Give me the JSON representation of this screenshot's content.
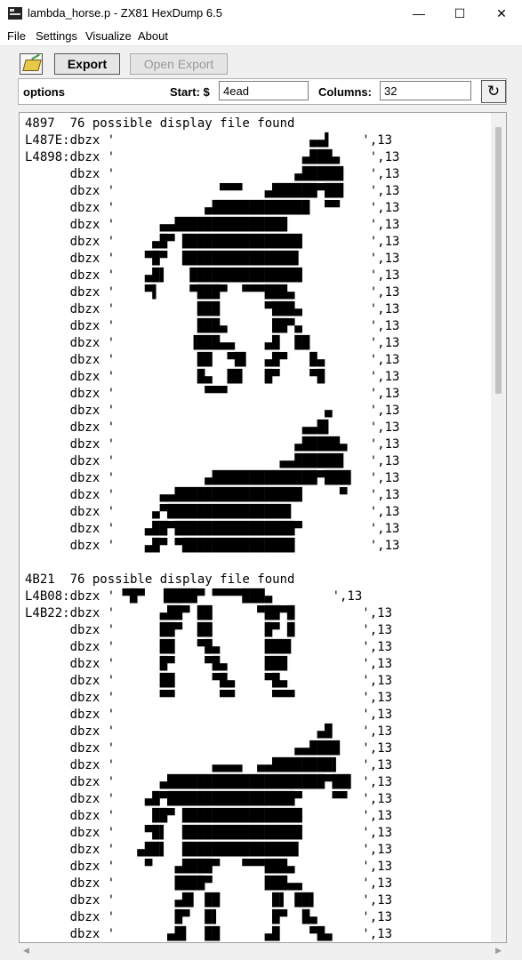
{
  "window": {
    "title": "lambda_horse.p - ZX81 HexDump 6.5",
    "minimize": "—",
    "maximize": "☐",
    "close": "✕"
  },
  "menu": [
    "File",
    "Settings",
    "Visualize",
    "About"
  ],
  "toolbar": {
    "open_icon": "open-folder-icon",
    "export_label": "Export",
    "open_export_label": "Open Export"
  },
  "options": {
    "label": "options",
    "start_label": "Start: $",
    "start_value": "4ead",
    "columns_label": "Columns:",
    "columns_value": "32",
    "refresh_icon": "↻"
  },
  "output_lines": [
    "4897  76 possible display file found",
    "L487E:dbzx '                          ▄▄▌    ',13",
    "L4898:dbzx '                         ▄███▄    ',13",
    "      dbzx '                        ▄█████▌   ',13",
    "      dbzx '              ▀▀▀   ▄██████▀██▌   ',13",
    "      dbzx '            ▄█████████████  ▀▀    ',13",
    "      dbzx '      ▄▄███████████████           ',13",
    "      dbzx '     ▄█▀ ████████████████         ',13",
    "      dbzx '    ▀█▀  ███████████████▌         ',13",
    "      dbzx '    ▄█▌   ███████████████         ',13",
    "      dbzx '    ▀▌    ▀███▀  ▀▀▀███▄          ',13",
    "      dbzx '           ███      ▀███▄         ',13",
    "      dbzx '           ███▄      ██▀▄         ',13",
    "      dbzx '          ▐███▄▄    ▄█  ██        ',13",
    "      dbzx '           ██  ▀█▌  ▄█▀   █▄      ',13",
    "      dbzx '           █▄  ██   █▀    ▀█      ',13",
    "      dbzx '            ▀▀▀                   ',13",
    "      dbzx '                            ▄     ',13",
    "      dbzx '                         ▄▄█▌     ',13",
    "      dbzx '                        ▄█████▄   ',13",
    "      dbzx '                      ▄▄██████▌   ',13",
    "      dbzx '            ▄██████████████▀███▌  ',13",
    "      dbzx '      ▄▄█████████████████     ▀   ',13",
    "      dbzx '     ▄▀████████████████▌          ',13",
    "      dbzx '    ▄██▀████████████████▀         ',13",
    "      dbzx '    ▄█▀ ▀███████████████          ',13",
    "",
    "4B21  76 possible display file found",
    "L4B08:dbzx ' ▀█▀  ▐████▀ ▀▀▀▀███▄        ',13",
    "L4B22:dbzx '      ▄██▀ ██      ▀██▀█         ',13",
    "      dbzx '      ██▀  ██       █▀ █         ',13",
    "      dbzx '      ██   ▀█▄      ███▌         ',13",
    "      dbzx '      █▀    ▀█▄     ███          ',13",
    "      dbzx '      ██     ▀█▄    ▀█▄          ',13",
    "      dbzx '      ▀▀      ▀▀     ▀▀▀         ',13",
    "      dbzx '                                 ',13",
    "      dbzx '                           ▄█    ',13",
    "      dbzx '                        ▄▄████   ',13",
    "      dbzx '             ▄▄▄▄  ▄▄████████▌   ',13",
    "      dbzx '      ▄█████████████████████▀██▌ ',13",
    "      dbzx '    ▄█▀█████████████████▀    ▀▀  ',13",
    "      dbzx '     ██▀ ████████████████        ',13",
    "      dbzx '    ▀█▌  ████████████████        ',13",
    "      dbzx '   ▄██▌  ███████████████▌        ',13",
    "      dbzx '    ▀   ▄████▀   ▀▀▀███▄         ',13",
    "      dbzx '        ████▀       ███▄▄        ',13",
    "      dbzx '        ▄█▌ ██       █▌ ██▌      ',13",
    "      dbzx '        █▀  █▌       █▀  █▄      ',13",
    "      dbzx '       ▄█▌  ██      ▄█    ▀█▄    ',13"
  ]
}
